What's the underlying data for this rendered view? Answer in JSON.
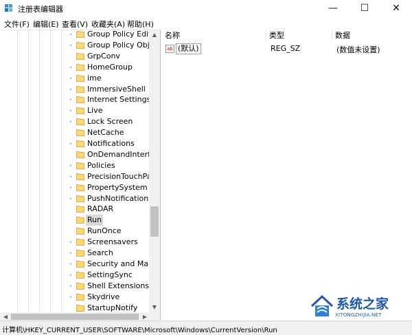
{
  "window": {
    "title": "注册表编辑器"
  },
  "controls": {
    "minimize": "—",
    "maximize": "☐",
    "close": "✕"
  },
  "menu": [
    "文件(F)",
    "编辑(E)",
    "查看(V)",
    "收藏夹(A)",
    "帮助(H)"
  ],
  "tree": {
    "items": [
      {
        "label": "Group Policy Editor",
        "expandable": true,
        "selected": false
      },
      {
        "label": "Group Policy Objec",
        "expandable": true,
        "selected": false
      },
      {
        "label": "GrpConv",
        "expandable": false,
        "selected": false
      },
      {
        "label": "HomeGroup",
        "expandable": true,
        "selected": false
      },
      {
        "label": "ime",
        "expandable": true,
        "selected": false
      },
      {
        "label": "ImmersiveShell",
        "expandable": true,
        "selected": false
      },
      {
        "label": "Internet Settings",
        "expandable": true,
        "selected": false
      },
      {
        "label": "Live",
        "expandable": true,
        "selected": false
      },
      {
        "label": "Lock Screen",
        "expandable": true,
        "selected": false
      },
      {
        "label": "NetCache",
        "expandable": false,
        "selected": false
      },
      {
        "label": "Notifications",
        "expandable": true,
        "selected": false
      },
      {
        "label": "OnDemandInterface",
        "expandable": false,
        "selected": false
      },
      {
        "label": "Policies",
        "expandable": true,
        "selected": false
      },
      {
        "label": "PrecisionTouchPad",
        "expandable": true,
        "selected": false
      },
      {
        "label": "PropertySystem",
        "expandable": true,
        "selected": false
      },
      {
        "label": "PushNotifications",
        "expandable": true,
        "selected": false
      },
      {
        "label": "RADAR",
        "expandable": false,
        "selected": false
      },
      {
        "label": "Run",
        "expandable": false,
        "selected": true
      },
      {
        "label": "RunOnce",
        "expandable": false,
        "selected": false
      },
      {
        "label": "Screensavers",
        "expandable": true,
        "selected": false
      },
      {
        "label": "Search",
        "expandable": true,
        "selected": false
      },
      {
        "label": "Security and Mainte",
        "expandable": true,
        "selected": false
      },
      {
        "label": "SettingSync",
        "expandable": true,
        "selected": false
      },
      {
        "label": "Shell Extensions",
        "expandable": true,
        "selected": false
      },
      {
        "label": "Skydrive",
        "expandable": true,
        "selected": false
      },
      {
        "label": "StartupNotify",
        "expandable": false,
        "selected": false
      }
    ]
  },
  "values": {
    "headers": {
      "name": "名称",
      "type": "类型",
      "data": "数据"
    },
    "rows": [
      {
        "icon": "ab",
        "name": "(默认)",
        "type": "REG_SZ",
        "data": "(数值未设置)"
      }
    ]
  },
  "status": {
    "path": "计算机\\HKEY_CURRENT_USER\\SOFTWARE\\Microsoft\\Windows\\CurrentVersion\\Run"
  },
  "watermark": {
    "text": "系统之家",
    "sub": "XITONGZHIJIA.NET"
  },
  "colors": {
    "folder": "#f8d775",
    "folder_dark": "#e0b040",
    "watermark": "#1c57a8"
  }
}
